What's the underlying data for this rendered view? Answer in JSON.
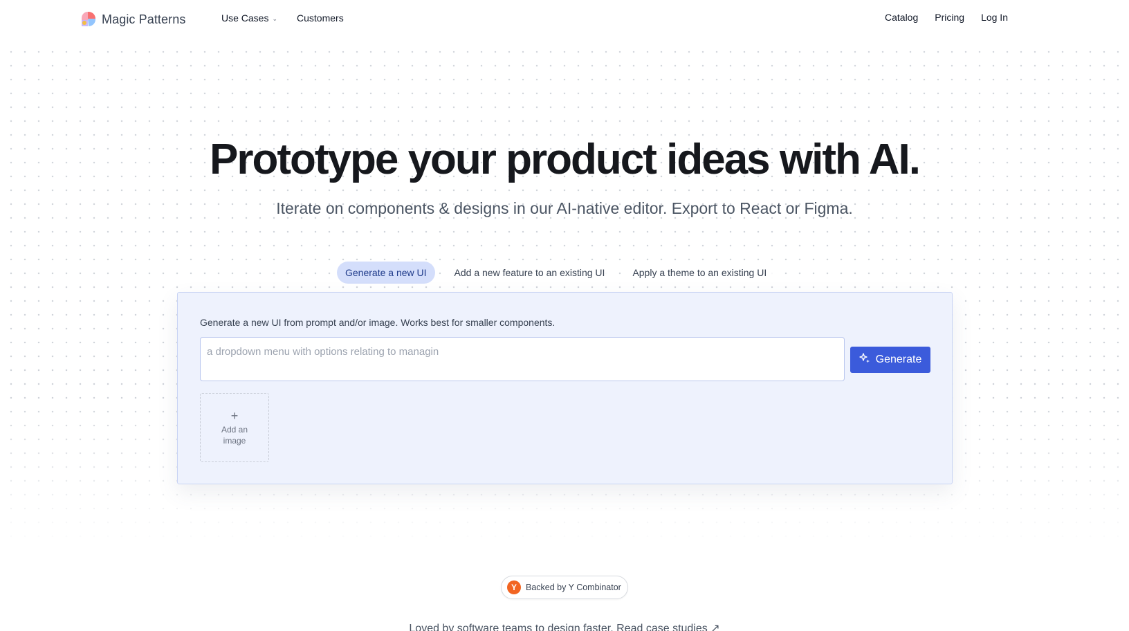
{
  "header": {
    "brand_name": "Magic Patterns",
    "nav_left": [
      {
        "label": "Use Cases",
        "has_dropdown": true
      },
      {
        "label": "Customers"
      }
    ],
    "nav_right": [
      {
        "label": "Catalog"
      },
      {
        "label": "Pricing"
      },
      {
        "label": "Log In"
      }
    ]
  },
  "hero": {
    "title": "Prototype your product ideas with AI.",
    "subtitle": "Iterate on components & designs in our AI-native editor. Export to React or Figma."
  },
  "tabs": [
    {
      "label": "Generate a new UI",
      "active": true
    },
    {
      "label": "Add a new feature to an existing UI",
      "active": false
    },
    {
      "label": "Apply a theme to an existing UI",
      "active": false
    }
  ],
  "card": {
    "description": "Generate a new UI from prompt and/or image. Works best for smaller components.",
    "prompt_value": "",
    "prompt_placeholder": "a dropdown menu with options relating to managin",
    "generate_label": "Generate",
    "add_image_label": "Add an image"
  },
  "badge": {
    "logo_letter": "Y",
    "label": "Backed by Y Combinator"
  },
  "footer_line": {
    "text": "Loved by software teams to design faster.",
    "link": "Read case studies ↗"
  },
  "colors": {
    "accent": "#3b5bdb",
    "active_tab_bg": "#d4defb",
    "card_bg": "#eef2fd",
    "yc_orange": "#f26522"
  },
  "icons": {
    "brand": "magic-patterns-logo",
    "dropdown": "chevron-down-icon",
    "generate": "sparkle-icon",
    "add_image": "plus-icon"
  }
}
